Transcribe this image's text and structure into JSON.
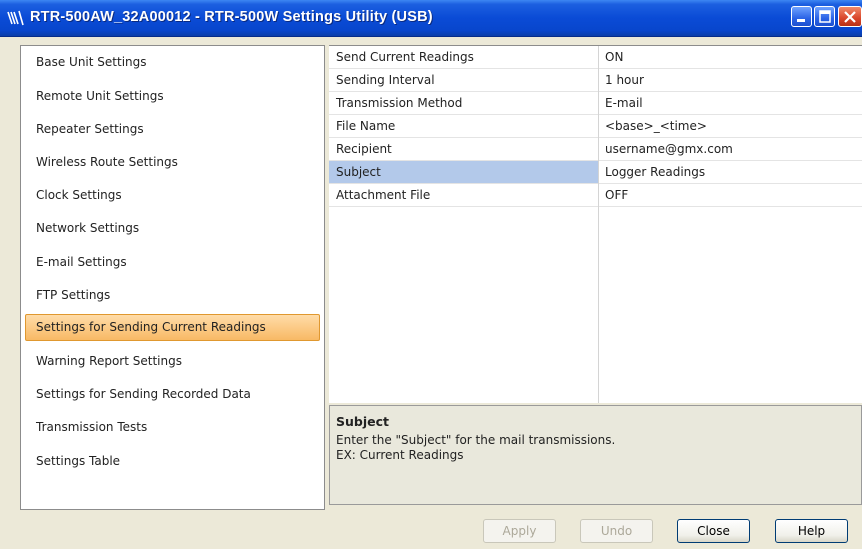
{
  "window": {
    "title": "RTR-500AW_32A00012 - RTR-500W Settings Utility (USB)",
    "icons": [
      "app-icon",
      "minimize-icon",
      "maximize-icon",
      "close-icon"
    ]
  },
  "nav": {
    "items": [
      {
        "label": "Base Unit Settings",
        "selected": false
      },
      {
        "label": "Remote Unit Settings",
        "selected": false
      },
      {
        "label": "Repeater Settings",
        "selected": false
      },
      {
        "label": "Wireless Route Settings",
        "selected": false
      },
      {
        "label": "Clock Settings",
        "selected": false
      },
      {
        "label": "Network Settings",
        "selected": false
      },
      {
        "label": "E-mail Settings",
        "selected": false
      },
      {
        "label": "FTP Settings",
        "selected": false
      },
      {
        "label": "Settings for Sending Current Readings",
        "selected": true
      },
      {
        "label": "Warning Report Settings",
        "selected": false
      },
      {
        "label": "Settings for Sending Recorded Data",
        "selected": false
      },
      {
        "label": "Transmission Tests",
        "selected": false
      },
      {
        "label": "Settings Table",
        "selected": false
      }
    ]
  },
  "grid": {
    "rows": [
      {
        "name": "Send Current Readings",
        "value": "ON"
      },
      {
        "name": "Sending Interval",
        "value": "1 hour"
      },
      {
        "name": "Transmission Method",
        "value": "E-mail"
      },
      {
        "name": "File Name",
        "value": "<base>_<time>"
      },
      {
        "name": "Recipient",
        "value": "username@gmx.com"
      },
      {
        "name": "Subject",
        "value": "Logger Readings",
        "selected": true
      },
      {
        "name": "Attachment File",
        "value": "OFF"
      }
    ]
  },
  "description": {
    "title": "Subject",
    "line1": "Enter the \"Subject\" for the mail transmissions.",
    "line2": "EX: Current Readings"
  },
  "buttons": {
    "apply": "Apply",
    "undo": "Undo",
    "close": "Close",
    "help": "Help"
  },
  "colors": {
    "titlebar": "#0a4bd6",
    "nav_selected": "#f8b965",
    "grid_selected": "#b3c9ea",
    "window_bg": "#ece9d8"
  }
}
